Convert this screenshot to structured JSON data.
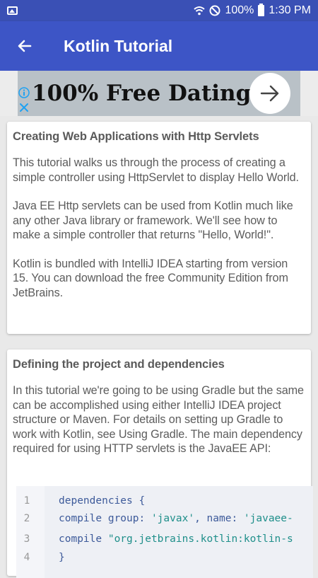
{
  "status_bar": {
    "battery_percent": "100%",
    "time": "1:30 PM"
  },
  "app_bar": {
    "title": "Kotlin Tutorial",
    "back_icon": "arrow-left-icon"
  },
  "ad": {
    "text": "100% Free Dating",
    "arrow_icon": "arrow-right-icon",
    "info_icon": "info-icon",
    "close_icon": "close-icon"
  },
  "sections": [
    {
      "title": "Creating Web Applications with Http Servlets",
      "paragraphs": [
        "This tutorial walks us through the process of creating a simple controller using HttpServlet to display Hello World.",
        "Java EE Http servlets can be used from Kotlin much like any other Java library or framework. We'll see how to make a simple controller that returns \"Hello, World!\".",
        "Kotlin is bundled with IntelliJ IDEA starting from version 15. You can download the free Community Edition from JetBrains."
      ]
    },
    {
      "title": "Defining the project and dependencies",
      "paragraphs": [
        "In this tutorial we're going to be using Gradle but the same can be accomplished using either IntelliJ IDEA project structure or Maven. For details on setting up Gradle to work with Kotlin, see Using Gradle. The main dependency required for using HTTP servlets is the JavaEE API:"
      ]
    }
  ],
  "code": {
    "line_numbers": [
      "1",
      "2",
      "3",
      "4"
    ],
    "lines": [
      [
        "dependencies {",
        ""
      ],
      [
        "compile group: ",
        "'javax'",
        ", name: ",
        "'javaee-"
      ],
      [
        "compile ",
        "\"org.jetbrains.kotlin:kotlin-s"
      ],
      [
        "}"
      ]
    ]
  }
}
